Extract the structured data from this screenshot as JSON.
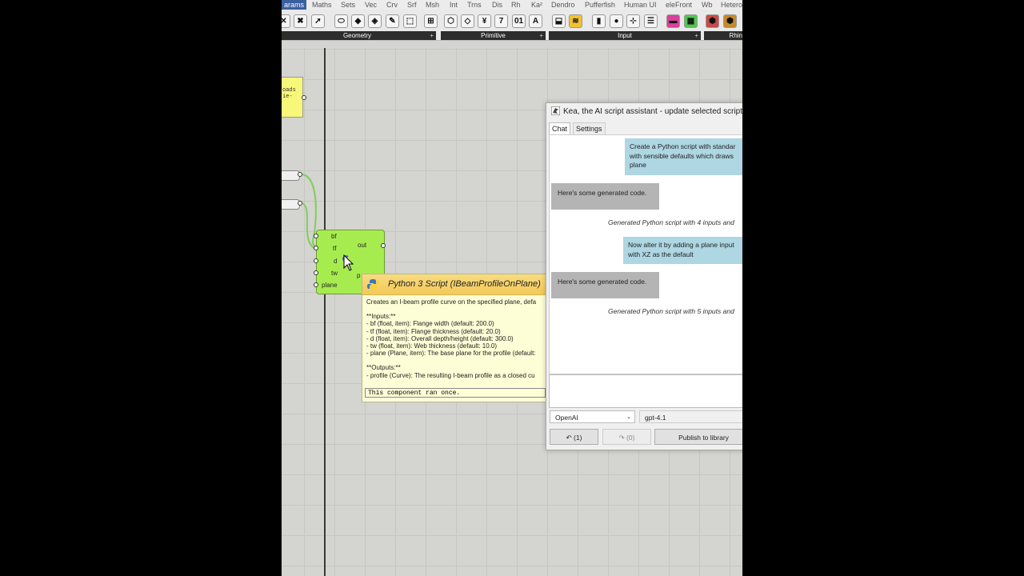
{
  "menu_tabs": [
    "arams",
    "Maths",
    "Sets",
    "Vec",
    "Crv",
    "Srf",
    "Msh",
    "Int",
    "Trns",
    "Dis",
    "Rh",
    "Ka²",
    "Dendro",
    "Pufferfish",
    "Human UI",
    "eleFront",
    "Wb",
    "Hetero"
  ],
  "toolbar_groups": {
    "geometry": "Geometry",
    "primitive": "Primitive",
    "input": "Input",
    "rhino": "Rhin"
  },
  "yellow_panel": {
    "line1": "oads",
    "line2": "ie-"
  },
  "component": {
    "inputs": [
      "bf",
      "tf",
      "d",
      "tw",
      "plane"
    ],
    "output": "out",
    "output2": "p"
  },
  "tooltip": {
    "title": "Python 3 Script (IBeamProfileOnPlane)",
    "description": "Creates an I-beam profile curve on the specified plane, defa",
    "inputs_header": "**Inputs:**",
    "inputs": [
      "- bf (float, item): Flange width (default: 200.0)",
      "- tf (float, item): Flange thickness (default: 20.0)",
      "- d (float, item): Overall depth/height (default: 300.0)",
      "- tw (float, item): Web thickness (default: 10.0)",
      "- plane (Plane, item): The base plane for the profile (default:"
    ],
    "outputs_header": "**Outputs:**",
    "outputs": [
      "- profile (Curve): The resulting I-beam profile as a closed cu"
    ],
    "status": "This component ran once."
  },
  "kea": {
    "title": "Kea, the AI script assistant - update selected script",
    "tabs": {
      "chat": "Chat",
      "settings": "Settings"
    },
    "messages": [
      {
        "role": "user",
        "text": "Create a Python script with standar\nwith sensible defaults which draws\nplane"
      },
      {
        "role": "ai",
        "text": "Here's some generated code."
      },
      {
        "role": "system",
        "text": "Generated Python script with 4 inputs  and"
      },
      {
        "role": "user",
        "text": "Now alter it by adding a plane input\nwith XZ as the default"
      },
      {
        "role": "ai",
        "text": "Here's some generated code."
      },
      {
        "role": "system",
        "text": "Generated Python script with 5 inputs  and"
      }
    ],
    "provider": "OpenAI",
    "model": "gpt-4.1",
    "undo_label": "↶ (1)",
    "redo_label": "↷ (0)",
    "publish_label": "Publish to library"
  },
  "colors": {
    "component_green": "#a7ec4f",
    "tooltip_header": "#f3c958",
    "user_bubble": "#aed6e3",
    "ai_bubble": "#b4b4b4"
  }
}
